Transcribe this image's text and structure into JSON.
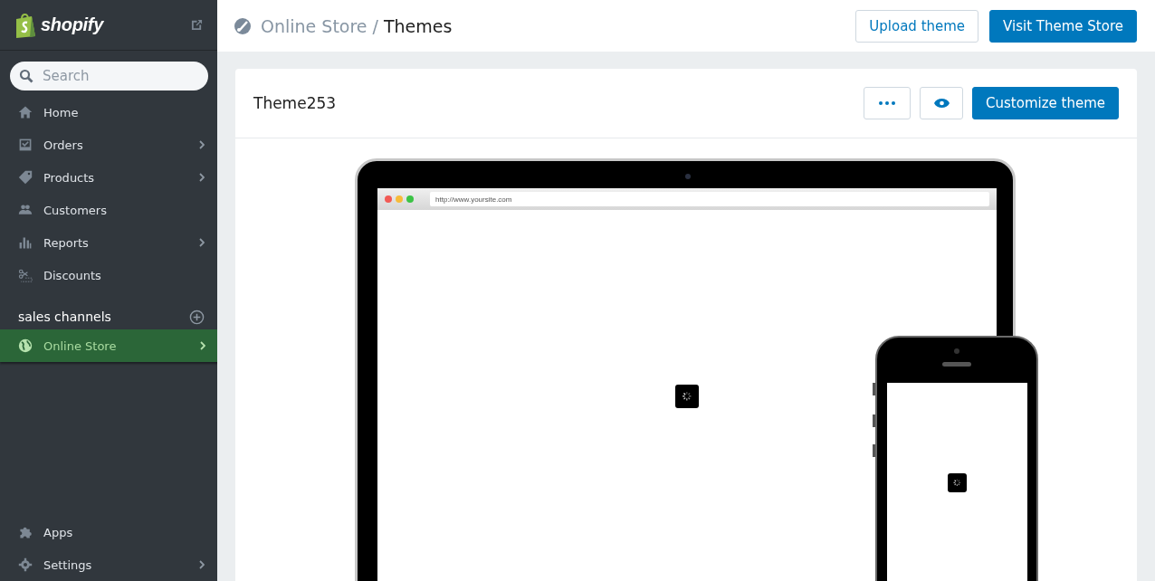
{
  "sidebar": {
    "brand": "shopify",
    "search": {
      "placeholder": "Search"
    },
    "nav_items": [
      {
        "label": "Home",
        "expandable": false
      },
      {
        "label": "Orders",
        "expandable": true
      },
      {
        "label": "Products",
        "expandable": true
      },
      {
        "label": "Customers",
        "expandable": false
      },
      {
        "label": "Reports",
        "expandable": true
      },
      {
        "label": "Discounts",
        "expandable": false
      }
    ],
    "sales_channels": {
      "heading": "sales channels",
      "items": [
        {
          "label": "Online Store",
          "expandable": true,
          "selected": true
        }
      ]
    },
    "bottom_items": [
      {
        "label": "Apps",
        "expandable": false
      },
      {
        "label": "Settings",
        "expandable": true
      }
    ]
  },
  "header": {
    "breadcrumb": {
      "parent": "Online Store",
      "separator": "/",
      "current": "Themes"
    },
    "buttons": [
      {
        "label": "Upload theme",
        "kind": "secondary"
      },
      {
        "label": "Visit Theme Store",
        "kind": "primary"
      }
    ]
  },
  "theme_card": {
    "title": "Theme253",
    "customize_button": "Customize theme",
    "preview": {
      "url": "http://www.yoursite.com"
    }
  }
}
